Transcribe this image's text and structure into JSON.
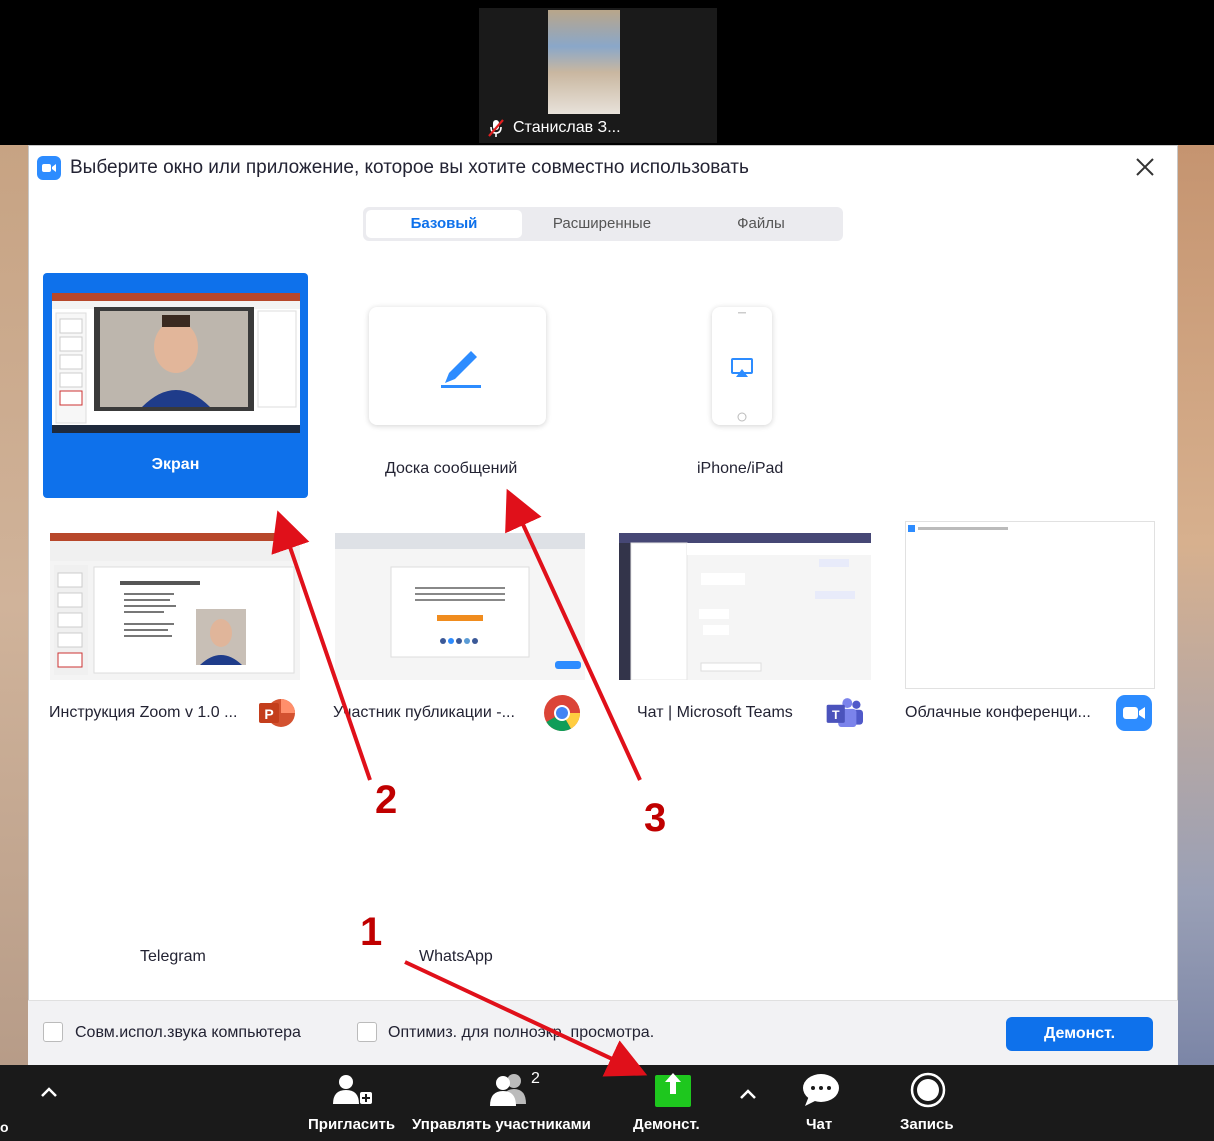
{
  "video": {
    "participant_name": "Станислав З..."
  },
  "dialog": {
    "title": "Выберите окно или приложение, которое вы хотите совместно использовать",
    "tabs": [
      {
        "label": "Базовый",
        "active": true
      },
      {
        "label": "Расширенные",
        "active": false
      },
      {
        "label": "Файлы",
        "active": false
      }
    ],
    "basic_options": {
      "screen": "Экран",
      "whiteboard": "Доска сообщений",
      "iphone": "iPhone/iPad"
    },
    "windows": [
      {
        "label": "Инструкция Zoom v 1.0 ...",
        "icon": "powerpoint-icon"
      },
      {
        "label": "Участник публикации -...",
        "icon": "chrome-icon"
      },
      {
        "label": "Чат | Microsoft Teams",
        "icon": "teams-icon"
      },
      {
        "label": "Облачные конференци...",
        "icon": "zoom-icon"
      }
    ],
    "apps": [
      {
        "label": "Telegram"
      },
      {
        "label": "WhatsApp"
      }
    ],
    "footer": {
      "share_sound": "Совм.испол.звука компьютера",
      "optimize_video": "Оптимиз. для полноэкр. просмотра.",
      "share_button": "Демонст."
    }
  },
  "toolbar": {
    "left_fragment": "о",
    "invite": "Пригласить",
    "manage_participants": "Управлять участниками",
    "participants_count": "2",
    "share": "Демонст.",
    "chat": "Чат",
    "record": "Запись"
  },
  "annotations": {
    "n1": "1",
    "n2": "2",
    "n3": "3"
  },
  "colors": {
    "accent": "#0e71eb",
    "share_green": "#1ec71e",
    "annotation_red": "#e0101a",
    "annotation_text": "#c00000"
  }
}
